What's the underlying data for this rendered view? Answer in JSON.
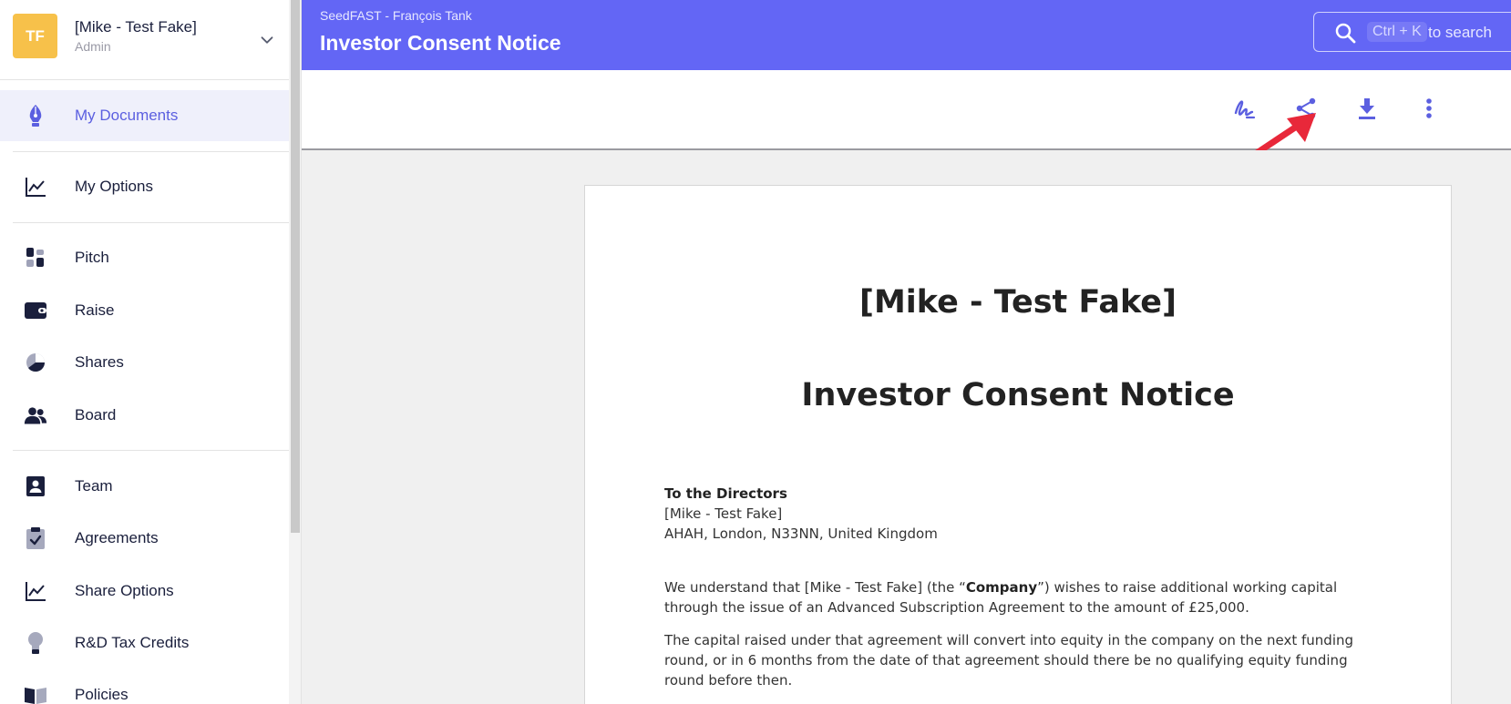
{
  "sidebar": {
    "user": {
      "initials": "TF",
      "name": "[Mike - Test Fake]",
      "role": "Admin",
      "avatar_color": "#f7c14a"
    },
    "items": [
      {
        "label": "My Documents",
        "icon": "pen-nib-icon",
        "active": true
      },
      {
        "label": "My Options",
        "icon": "chart-line-icon"
      },
      {
        "label": "Pitch",
        "icon": "layout-blocks-icon"
      },
      {
        "label": "Raise",
        "icon": "wallet-icon"
      },
      {
        "label": "Shares",
        "icon": "pie-chart-icon"
      },
      {
        "label": "Board",
        "icon": "people-icon"
      },
      {
        "label": "Team",
        "icon": "id-badge-icon"
      },
      {
        "label": "Agreements",
        "icon": "clipboard-check-icon"
      },
      {
        "label": "Share Options",
        "icon": "chart-line-icon"
      },
      {
        "label": "R&D Tax Credits",
        "icon": "lightbulb-icon"
      },
      {
        "label": "Policies",
        "icon": "book-icon"
      }
    ]
  },
  "header": {
    "breadcrumb": "SeedFAST - François Tank",
    "title": "Investor Consent Notice",
    "search": {
      "shortcut": "Ctrl + K",
      "hint": "to search"
    },
    "bg_color": "#6366f5"
  },
  "toolbar": {
    "actions": [
      {
        "name": "sign-icon"
      },
      {
        "name": "share-icon"
      },
      {
        "name": "download-icon"
      },
      {
        "name": "more-vertical-icon"
      }
    ],
    "icon_color": "#5b5fe0"
  },
  "document": {
    "company": "[Mike - Test Fake]",
    "title": "Investor Consent Notice",
    "addressee": "To the Directors",
    "company_line": "[Mike - Test Fake]",
    "address": "AHAH, London, N33NN, United Kingdom",
    "para1_pre": "We understand that [Mike - Test Fake] (the “",
    "para1_bold": "Company",
    "para1_post": "”) wishes to raise additional working capital through the issue of an Advanced Subscription Agreement to the amount of £25,000.",
    "para2": "The capital raised under that agreement will convert into equity in the company on the next funding round, or in 6 months from the date of that agreement should there be no qualifying equity funding round before then."
  },
  "annotation_color": "#e8283a"
}
